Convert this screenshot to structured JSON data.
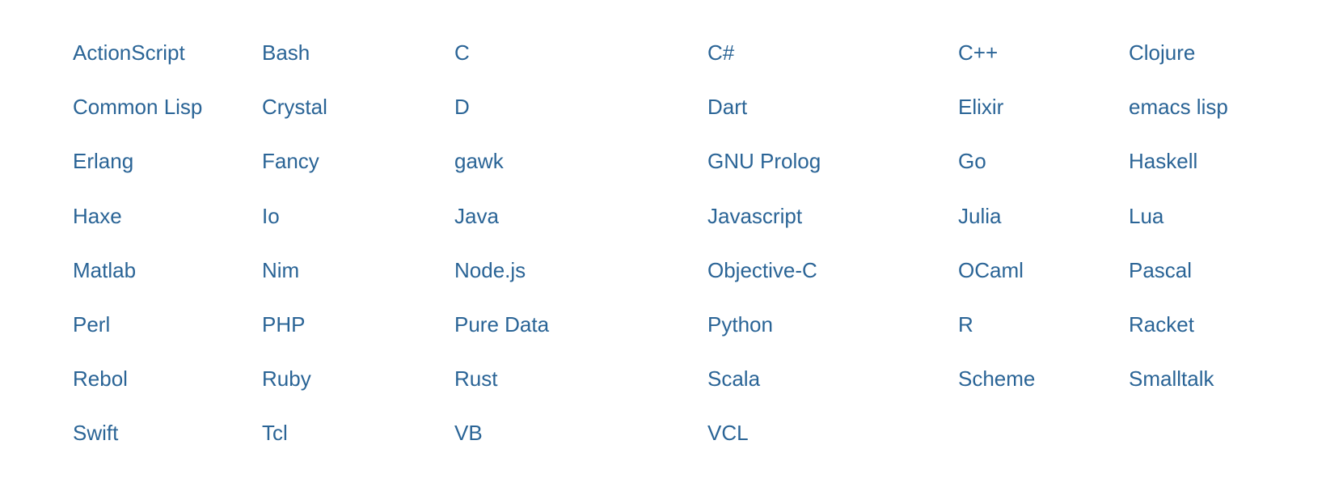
{
  "languages": [
    "ActionScript",
    "Bash",
    "C",
    "C#",
    "C++",
    "Clojure",
    "Common Lisp",
    "Crystal",
    "D",
    "Dart",
    "Elixir",
    "emacs lisp",
    "Erlang",
    "Fancy",
    "gawk",
    "GNU Prolog",
    "Go",
    "Haskell",
    "Haxe",
    "Io",
    "Java",
    "Javascript",
    "Julia",
    "Lua",
    "Matlab",
    "Nim",
    "Node.js",
    "Objective-C",
    "OCaml",
    "Pascal",
    "Perl",
    "PHP",
    "Pure Data",
    "Python",
    "R",
    "Racket",
    "Rebol",
    "Ruby",
    "Rust",
    "Scala",
    "Scheme",
    "Smalltalk",
    "Swift",
    "Tcl",
    "VB",
    "VCL"
  ]
}
